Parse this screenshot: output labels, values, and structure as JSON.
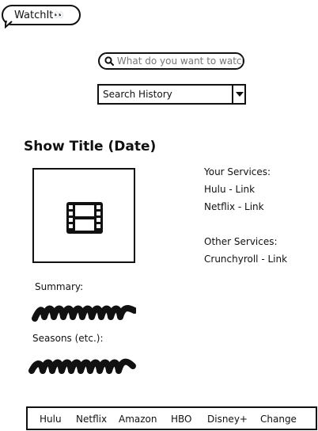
{
  "logo": {
    "text": "WatchIt",
    "eyes": "👀"
  },
  "search": {
    "placeholder": "What do you want to watch?",
    "value": ""
  },
  "history_dropdown": {
    "selected": "Search History"
  },
  "show": {
    "title": "Show Title (Date)"
  },
  "services": {
    "your_label": "Your Services:",
    "your": [
      "Hulu - Link",
      "Netflix - Link"
    ],
    "other_label": "Other Services:",
    "other": [
      "Crunchyroll - Link"
    ]
  },
  "summary": {
    "label": "Summary:"
  },
  "seasons": {
    "label": "Seasons (etc.):"
  },
  "bottom_nav": {
    "items": [
      "Hulu",
      "Netflix",
      "Amazon",
      "HBO",
      "Disney+",
      "Change"
    ]
  },
  "icons": {
    "search": "magnifier-icon",
    "dropdown": "caret-down-icon",
    "poster": "film-icon"
  }
}
